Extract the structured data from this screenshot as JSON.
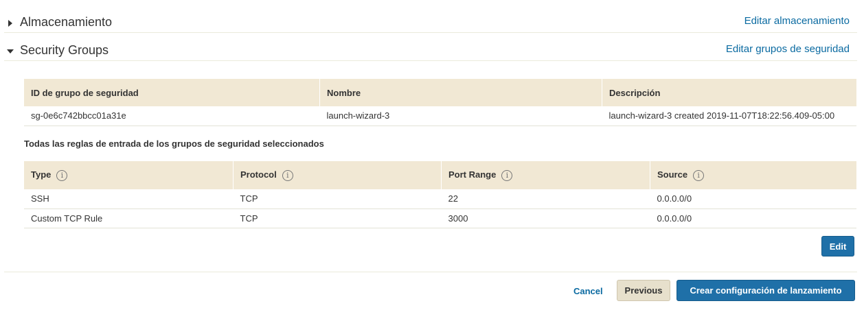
{
  "storage_section": {
    "title": "Almacenamiento",
    "edit_link": "Editar almacenamiento"
  },
  "security_section": {
    "title": "Security Groups",
    "edit_link": "Editar grupos de seguridad"
  },
  "groups_table": {
    "headers": [
      "ID de grupo de seguridad",
      "Nombre",
      "Descripción"
    ],
    "rows": [
      [
        "sg-0e6c742bbcc01a31e",
        "launch-wizard-3",
        "launch-wizard-3 created 2019-11-07T18:22:56.409-05:00"
      ]
    ]
  },
  "rules_heading": "Todas las reglas de entrada de los grupos de seguridad seleccionados",
  "rules_table": {
    "headers": [
      "Type",
      "Protocol",
      "Port Range",
      "Source"
    ],
    "info_glyph": "i",
    "rows": [
      [
        "SSH",
        "TCP",
        "22",
        "0.0.0.0/0"
      ],
      [
        "Custom TCP Rule",
        "TCP",
        "3000",
        "0.0.0.0/0"
      ]
    ]
  },
  "buttons": {
    "edit": "Edit",
    "cancel": "Cancel",
    "previous": "Previous",
    "create": "Crear configuración de lanzamiento"
  },
  "colors": {
    "link": "#0a6aa1",
    "primary_button": "#1f70a8",
    "table_header": "#f1e8d4",
    "secondary_button": "#e7e0cc"
  }
}
